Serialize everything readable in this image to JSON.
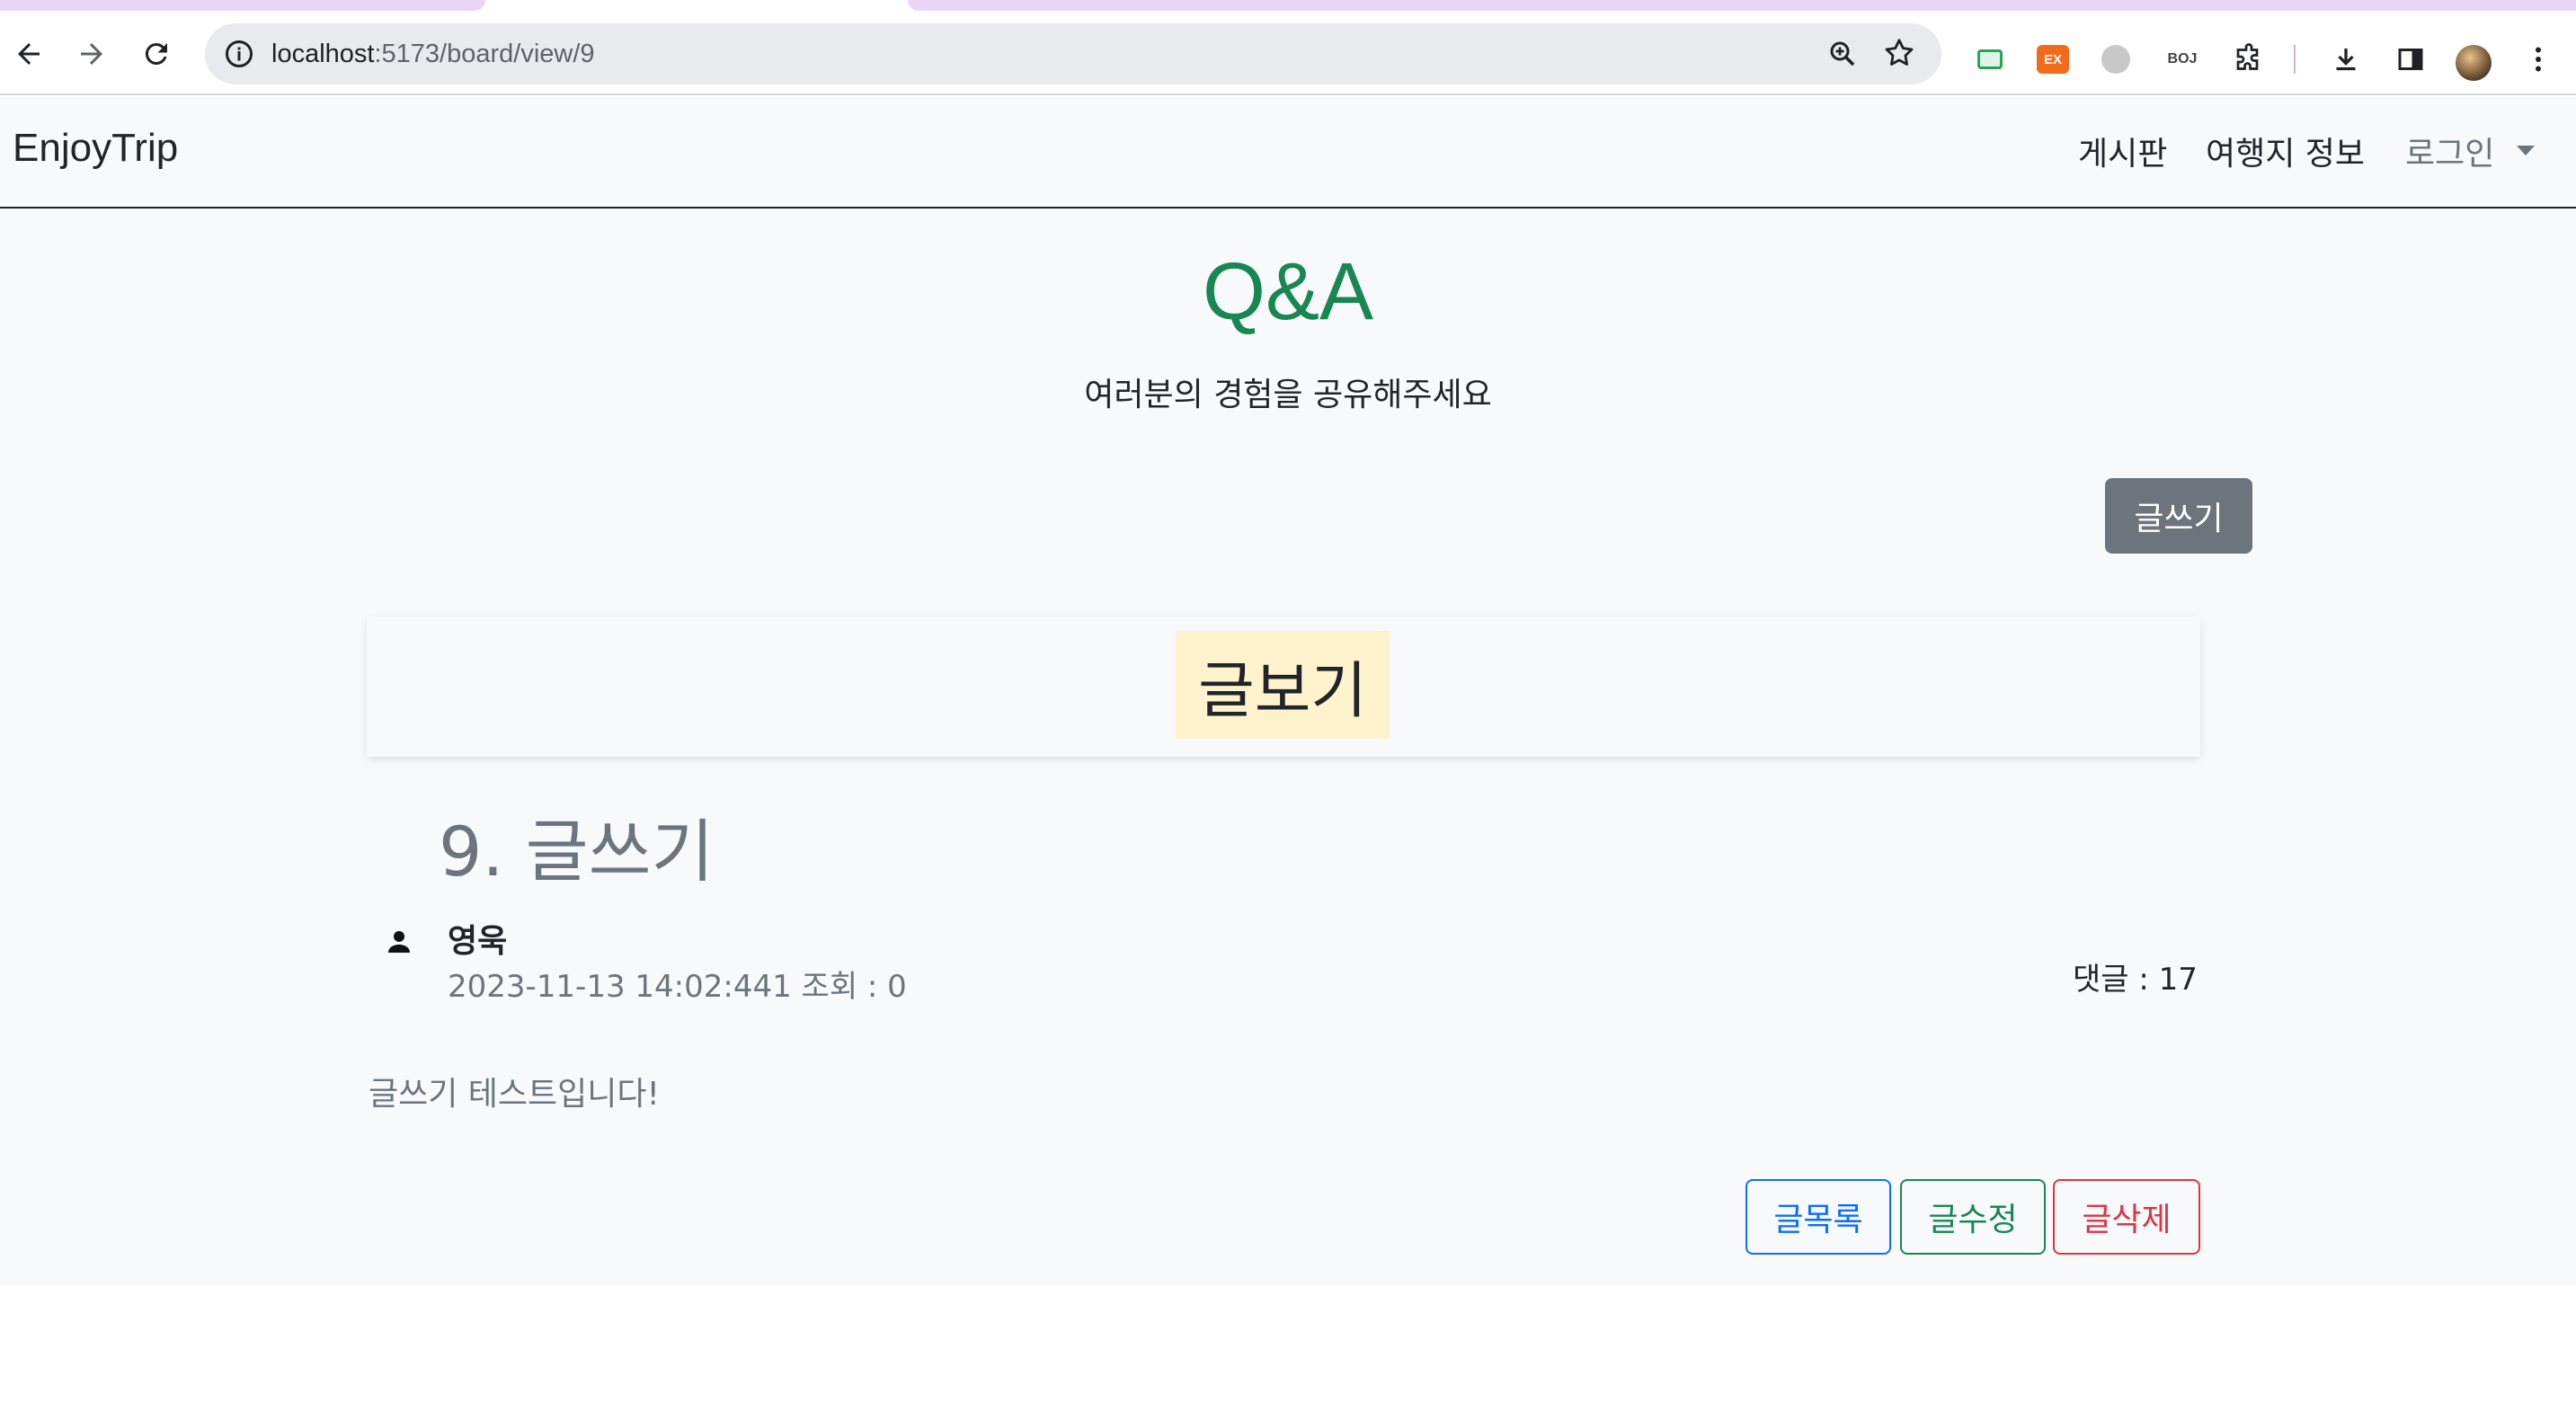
{
  "browser": {
    "url_host": "localhost",
    "url_path": ":5173/board/view/9",
    "extensions": {
      "ex_label": "EX",
      "boj_label": "BOJ"
    }
  },
  "navbar": {
    "brand": "EnjoyTrip",
    "links": {
      "board": "게시판",
      "trip": "여행지 정보",
      "login": "로그인"
    }
  },
  "header": {
    "title": "Q&A",
    "subtitle": "여러분의 경험을 공유해주세요"
  },
  "toolbar": {
    "write_label": "글쓰기"
  },
  "view_card": {
    "label": "글보기"
  },
  "post": {
    "title": "9. 글쓰기",
    "author": "영욱",
    "meta": "2023-11-13 14:02:441 조회 : 0",
    "comments": "댓글 : 17",
    "content": "글쓰기 테스트입니다!"
  },
  "actions": {
    "list_label": "글목록",
    "edit_label": "글수정",
    "delete_label": "글삭제"
  },
  "colors": {
    "accent_green": "#198754",
    "primary": "#0d6efd",
    "danger": "#dc3545",
    "secondary": "#6c757d",
    "highlight": "#fff3cd"
  }
}
